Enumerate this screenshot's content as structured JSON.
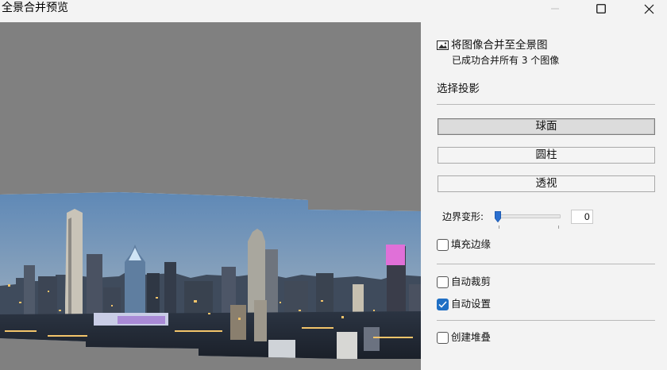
{
  "window": {
    "title": "全景合并预览",
    "controls": [
      "minimize-icon",
      "maximize-icon",
      "close-icon"
    ]
  },
  "info": {
    "icon": "panorama-image-icon",
    "title": "将图像合并至全景图",
    "subtitle": "已成功合并所有 3 个图像"
  },
  "projection": {
    "label": "选择投影",
    "options": [
      {
        "label": "球面",
        "selected": true
      },
      {
        "label": "圆柱",
        "selected": false
      },
      {
        "label": "透视",
        "selected": false
      }
    ]
  },
  "boundary_warp": {
    "label": "边界变形:",
    "value": "0",
    "level": 0
  },
  "options": {
    "fill_edges": {
      "label": "填充边缘",
      "checked": false
    },
    "auto_crop": {
      "label": "自动裁剪",
      "checked": false
    },
    "auto_settings": {
      "label": "自动设置",
      "checked": true
    },
    "create_stack": {
      "label": "创建堆叠",
      "checked": false
    }
  },
  "colors": {
    "accent": "#1f6fc4",
    "preview_background": "#808080",
    "sky_top": "#5e88b6",
    "sky_bottom": "#9bb0c4",
    "city_lights": "#f2c46a",
    "magenta_tower": "#e070d8"
  }
}
